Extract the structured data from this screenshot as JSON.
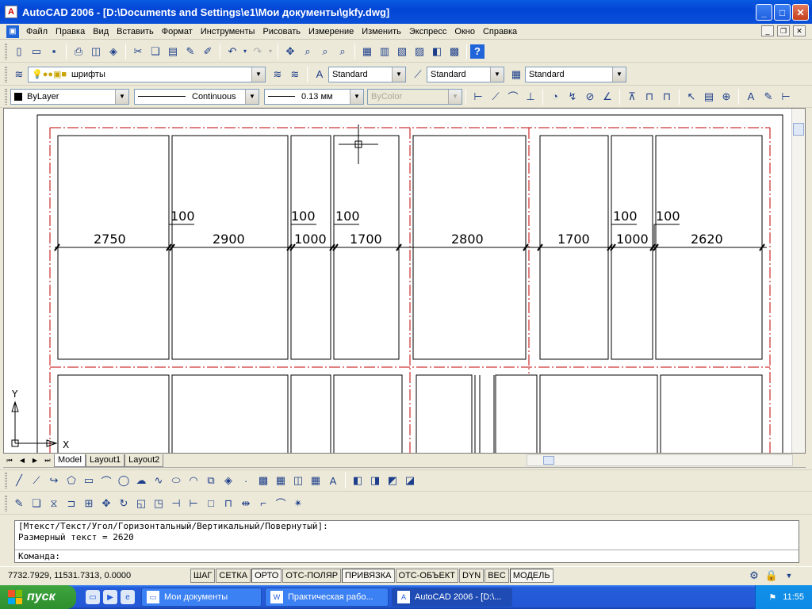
{
  "window": {
    "title": "AutoCAD 2006 - [D:\\Documents and Settings\\e1\\Мои документы\\gkfy.dwg]",
    "app_icon": "A"
  },
  "menu": [
    "Файл",
    "Правка",
    "Вид",
    "Вставить",
    "Формат",
    "Инструменты",
    "Рисовать",
    "Измерение",
    "Изменить",
    "Экспресс",
    "Окно",
    "Справка"
  ],
  "layers": {
    "current": "шрифты"
  },
  "styles": {
    "text": "Standard",
    "dim": "Standard",
    "table": "Standard"
  },
  "properties": {
    "color": "ByLayer",
    "linetype": "Continuous",
    "lineweight": "0.13 мм",
    "plotstyle": "ByColor"
  },
  "drawing": {
    "dimensions_top": [
      "2750",
      "2900",
      "1000",
      "1700",
      "2800",
      "1700",
      "1000",
      "2620"
    ],
    "dimensions_small": [
      "100",
      "100",
      "100",
      "100",
      "100"
    ],
    "ucs_x": "X",
    "ucs_y": "Y"
  },
  "tabs": [
    "Model",
    "Layout1",
    "Layout2"
  ],
  "command": {
    "line1": "[Мтекст/Текст/Угол/Горизонтальный/Вертикальный/Повернутый]:",
    "line2": "Размерный текст = 2620",
    "prompt": "Команда:"
  },
  "status": {
    "coords": "7732.7929, 11531.7313, 0.0000",
    "buttons": [
      {
        "label": "ШАГ",
        "on": false
      },
      {
        "label": "СЕТКА",
        "on": false
      },
      {
        "label": "ОРТО",
        "on": true
      },
      {
        "label": "ОТС-ПОЛЯР",
        "on": false
      },
      {
        "label": "ПРИВЯЗКА",
        "on": true
      },
      {
        "label": "ОТС-ОБЪЕКТ",
        "on": false
      },
      {
        "label": "DYN",
        "on": false
      },
      {
        "label": "ВЕС",
        "on": false
      },
      {
        "label": "МОДЕЛЬ",
        "on": true
      }
    ]
  },
  "taskbar": {
    "start": "пуск",
    "tasks": [
      "Мои документы",
      "Практическая рабо...",
      "AutoCAD 2006 - [D:\\..."
    ],
    "clock": "11:55"
  }
}
